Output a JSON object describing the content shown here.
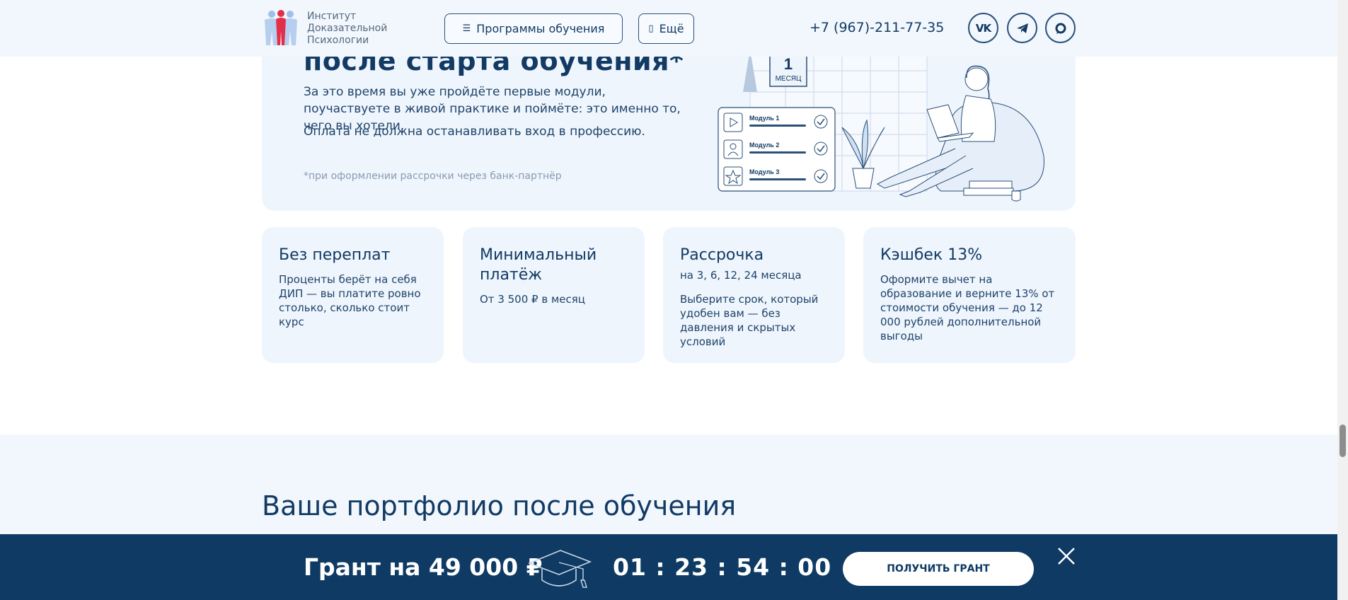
{
  "header": {
    "logo_line1": "Институт",
    "logo_line2": "Доказательной",
    "logo_line3": "Психологии",
    "programs_label": "Программы обучения",
    "more_label": "Ещё",
    "phone": "+7 (967)-211-77-35",
    "social": [
      "vk-icon",
      "telegram-icon",
      "max-icon"
    ]
  },
  "hero": {
    "title": "после старта обучения*",
    "p1": "За это время вы уже пройдёте первые модули, поучаствуете в живой практике и поймёте: это именно то, чего вы хотели.",
    "p2": "Оплата не должна останавливать вход в профессию.",
    "note": "*при оформлении рассрочки через банк-партнёр",
    "calendar_number": "1",
    "calendar_unit": "МЕСЯЦ",
    "modules": [
      "Модуль 1",
      "Модуль 2",
      "Модуль 3"
    ]
  },
  "features": [
    {
      "title": "Без переплат",
      "subtitle": "",
      "text": "Проценты берёт на себя ДИП — вы платите ровно столько, сколько стоит курс"
    },
    {
      "title": "Минимальный платёж",
      "subtitle": "",
      "text": "От 3 500 ₽ в месяц"
    },
    {
      "title": "Рассрочка",
      "subtitle": "на 3, 6, 12, 24 месяца",
      "text": "Выберите срок, который удобен вам — без давления и скрытых условий"
    },
    {
      "title": "Кэшбек 13%",
      "subtitle": "",
      "text": "Оформите вычет на образование и верните 13% от стоимости обучения — до 12 000 рублей дополнительной выгоды"
    }
  ],
  "section2": {
    "title": "Ваше портфолио после обучения"
  },
  "banner": {
    "title": "Грант на 49 000 ₽",
    "timer": "01 : 23 : 54 : 00",
    "button": "ПОЛУЧИТЬ ГРАНТ"
  },
  "colors": {
    "navy": "#0e3a63",
    "card_bg": "#eef5fd",
    "header_bg": "#f1f7fd",
    "logo_red": "#e2304a",
    "logo_blue": "#9fbfe6"
  }
}
